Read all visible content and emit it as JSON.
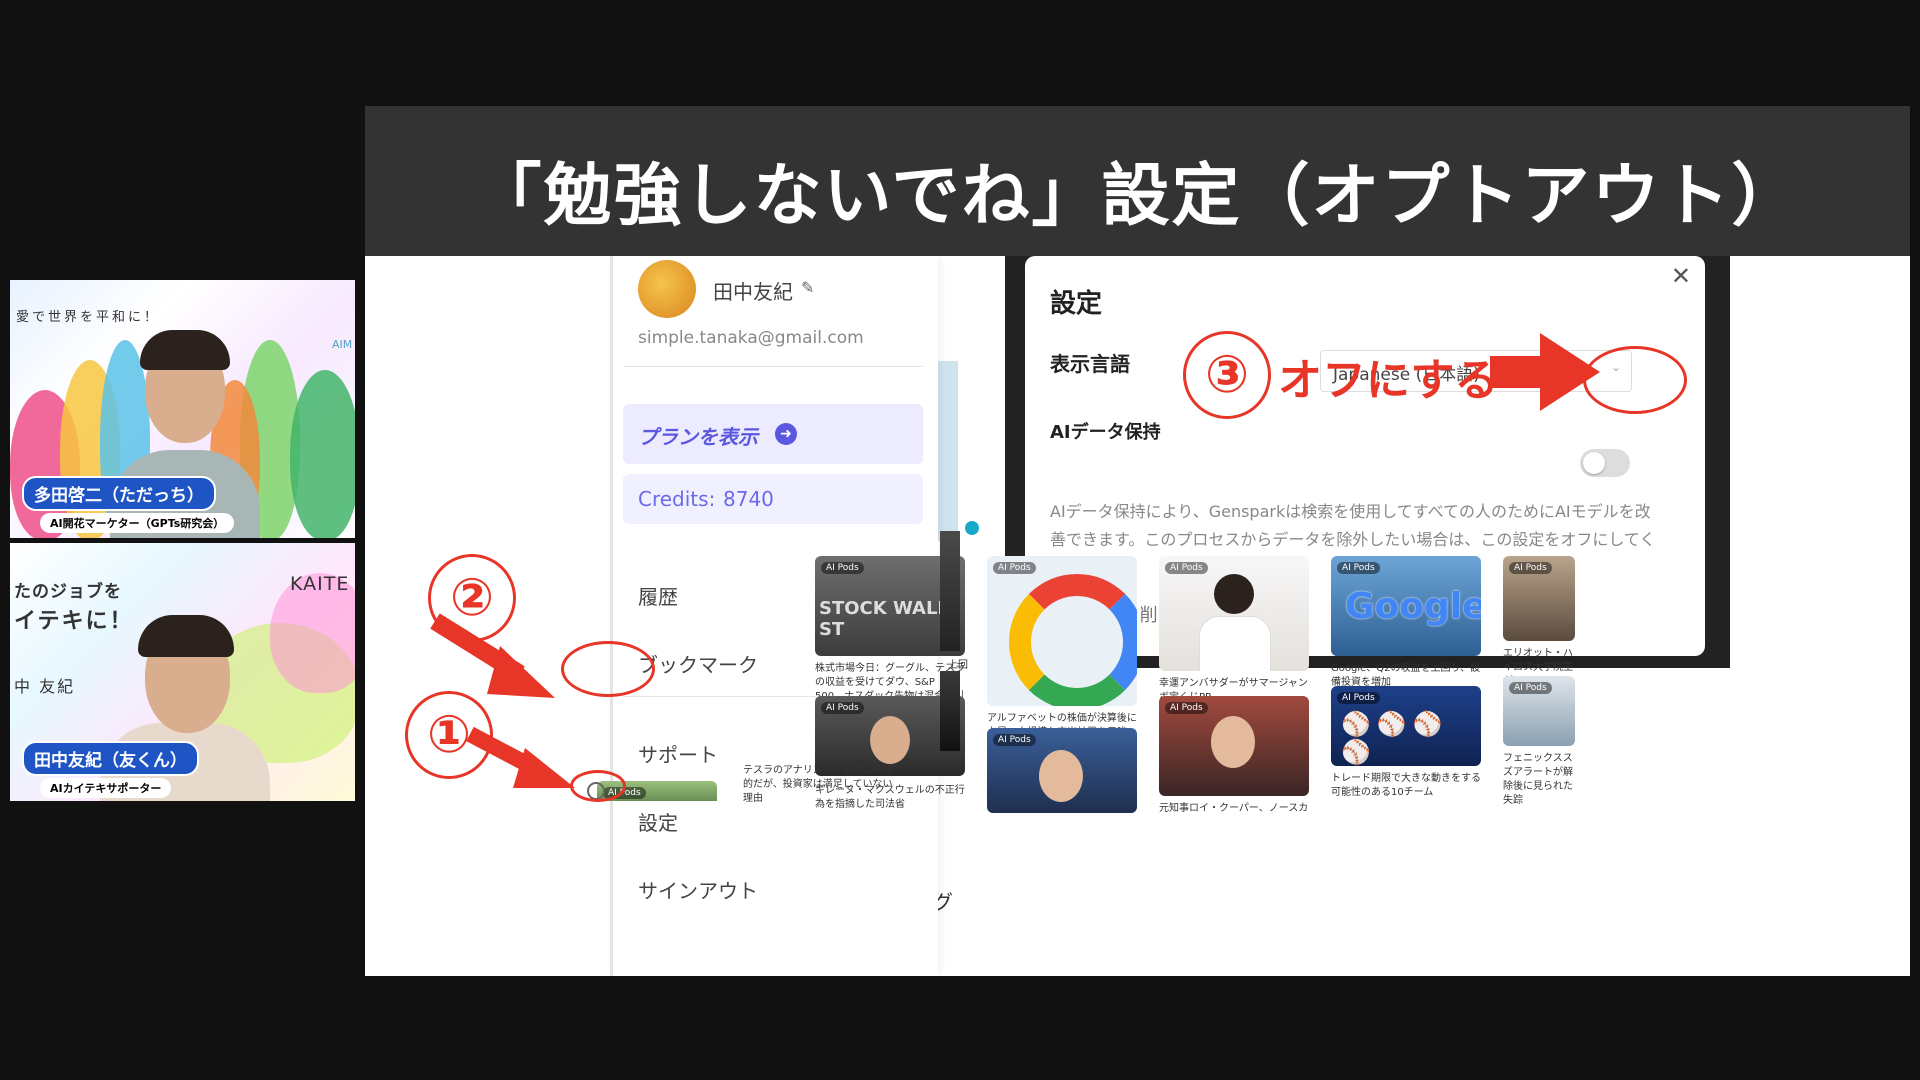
{
  "slide": {
    "title": "「勉強しないでね」設定（オプトアウト）"
  },
  "webcams": [
    {
      "name": "多田啓二（ただっち）",
      "role": "AI開花マーケター（GPTs研究会）",
      "bg_text": "愛で世界を平和に！",
      "corner_text": "AIM"
    },
    {
      "name": "田中友紀（友くん）",
      "role": "AIカイテキサポーター",
      "bg_text_1": "たのジョブを",
      "bg_text_2": "イテキに！",
      "bg_text_3": "中 友紀",
      "corner_text": "KAITE"
    }
  ],
  "menu": {
    "user_name": "田中友紀",
    "email": "simple.tanaka@gmail.com",
    "plan_label": "プランを表示",
    "credits_label": "Credits:",
    "credits_value": "8740",
    "items": [
      "履歴",
      "ブックマーク",
      "サポート",
      "設定",
      "サインアウト"
    ]
  },
  "settings_modal": {
    "title": "設定",
    "language_label": "表示言語",
    "language_value": "Japanese (日本語)",
    "ai_data_label": "AIデータ保持",
    "ai_data_enabled": false,
    "description": "AIデータ保持により、Gensparkは検索を使用してすべての人のためにAIモデルを改善できます。このプロセスからデータを除外したい場合は、この設定をオフにしてください。",
    "delete_user": "ユーザーを削除",
    "close_icon": "close-icon"
  },
  "annotations": {
    "step1": "①",
    "step2": "②",
    "step3": "③",
    "off_text": "オフにする",
    "color": "#e73528"
  },
  "news_cards": [
    {
      "pod": "AI Pods",
      "caption": "株式市場今日：グーグル、テスラの収益を受けてダウ、S&P 500、ナスダック先物は混合取引",
      "img_text": "STOCK WALL ST"
    },
    {
      "pod": "AI Pods",
      "caption": "アルファベットの株価が決算後に上昇、大規模な支出計画を示唆",
      "img_text": ""
    },
    {
      "pod": "AI Pods",
      "caption": "幸運アンバサダーがサマージャンボ宝くじPR",
      "img_text": ""
    },
    {
      "pod": "AI Pods",
      "caption": "Google、Q2の収益を上回り、設備投資を増加",
      "img_text": "Google"
    },
    {
      "pod": "AI Pods",
      "caption": "エリオット・ハイロス大学院生が",
      "img_text": ""
    },
    {
      "pod": "AI Pods",
      "caption": "ギレーヌ・マクスウェルの不正行為を指摘した司法省",
      "img_text": ""
    },
    {
      "pod": "AI Pods",
      "caption": "",
      "img_text": ""
    },
    {
      "pod": "AI Pods",
      "caption": "元知事ロイ・クーパー、ノースカ",
      "img_text": ""
    },
    {
      "pod": "AI Pods",
      "caption": "トレード期限で大きな動きをする可能性のある10チーム",
      "img_text": ""
    },
    {
      "pod": "AI Pods",
      "caption": "フェニックススズアラートが解除後に見られた失踪",
      "img_text": ""
    }
  ],
  "misc_text": {
    "tesla_caption": "テスラのアナリストは業績に楽観的だが、投資家は満足していない理由",
    "pod": "AI Pods",
    "left_label": "上回",
    "left_label2": "ジ",
    "left_label3": "グ"
  }
}
